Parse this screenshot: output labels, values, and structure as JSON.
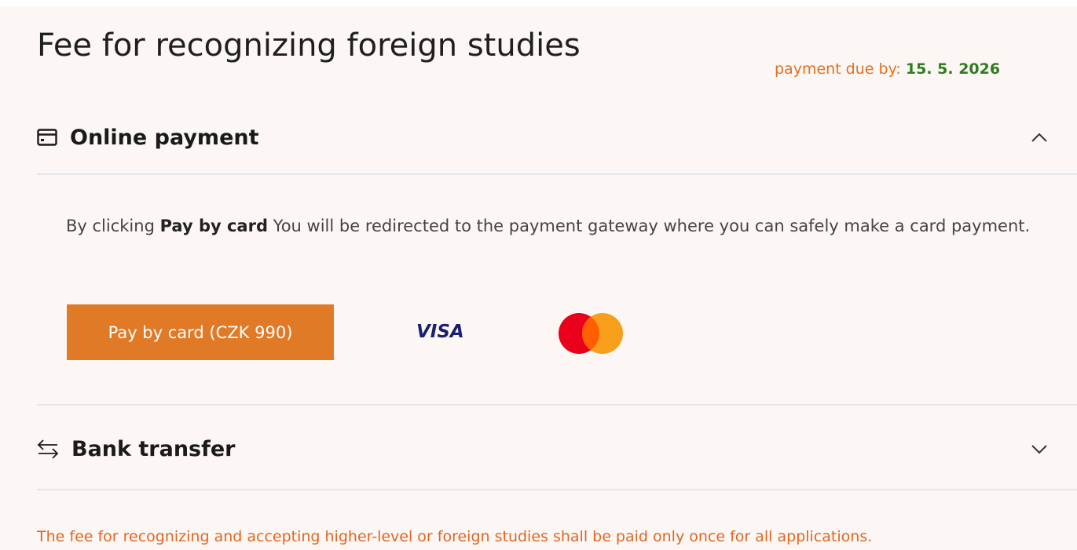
{
  "header": {
    "title": "Fee for recognizing foreign studies",
    "due_label": "payment due by: ",
    "due_date": "15. 5. 2026"
  },
  "online": {
    "label": "Online payment",
    "icon": "credit-card-icon",
    "expanded": true,
    "desc_pre": "By clicking ",
    "desc_bold": "Pay by card",
    "desc_post": " You will be redirected to the payment gateway where you can safely make a card payment.",
    "button_label": "Pay by card (CZK 990)",
    "visa": "VISA"
  },
  "bank": {
    "label": "Bank transfer",
    "icon": "transfer-arrows-icon",
    "expanded": false
  },
  "note": "The fee for recognizing and accepting higher-level or foreign studies shall be paid only once for all applications.",
  "colors": {
    "accent": "#e07a26",
    "due_date": "#2e7d1e",
    "background": "#fcf7f4"
  }
}
